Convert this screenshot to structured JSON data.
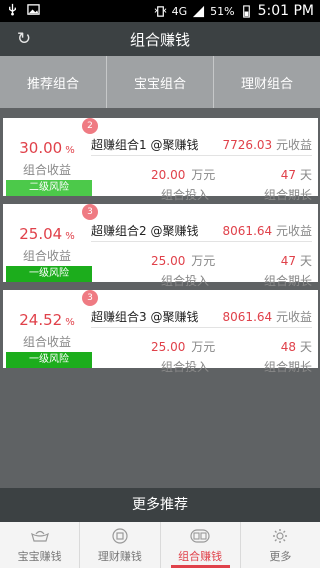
{
  "status_bar": {
    "network": "4G",
    "battery": "51%",
    "time": "5:01 PM"
  },
  "header": {
    "title": "组合赚钱",
    "refresh_icon": "refresh-icon"
  },
  "tabs": [
    {
      "label": "推荐组合"
    },
    {
      "label": "宝宝组合"
    },
    {
      "label": "理财组合"
    }
  ],
  "portfolios": [
    {
      "badge": "2",
      "rate": "30.00",
      "rate_unit": "%",
      "rate_label": "组合收益",
      "risk": "二级风险",
      "risk_color": "#4cc94a",
      "name": "超赚组合1 @聚赚钱",
      "income": "7726.03",
      "income_unit": "元收益",
      "amount": "20.00",
      "amount_unit": "万元",
      "amount_label": "组合投入",
      "duration": "47",
      "duration_unit": "天",
      "duration_label": "组合期长"
    },
    {
      "badge": "3",
      "rate": "25.04",
      "rate_unit": "%",
      "rate_label": "组合收益",
      "risk": "一级风险",
      "risk_color": "#1cad1c",
      "name": "超赚组合2 @聚赚钱",
      "income": "8061.64",
      "income_unit": "元收益",
      "amount": "25.00",
      "amount_unit": "万元",
      "amount_label": "组合投入",
      "duration": "47",
      "duration_unit": "天",
      "duration_label": "组合期长"
    },
    {
      "badge": "3",
      "rate": "24.52",
      "rate_unit": "%",
      "rate_label": "组合收益",
      "risk": "一级风险",
      "risk_color": "#1cad1c",
      "name": "超赚组合3 @聚赚钱",
      "income": "8061.64",
      "income_unit": "元收益",
      "amount": "25.00",
      "amount_unit": "万元",
      "amount_label": "组合投入",
      "duration": "48",
      "duration_unit": "天",
      "duration_label": "组合期长"
    }
  ],
  "more_button": "更多推荐",
  "bottom_nav": [
    {
      "label": "宝宝赚钱",
      "icon": "ingot-icon"
    },
    {
      "label": "理财赚钱",
      "icon": "coin-icon"
    },
    {
      "label": "组合赚钱",
      "icon": "coins-icon",
      "active": true
    },
    {
      "label": "更多",
      "icon": "gear-icon"
    }
  ],
  "colors": {
    "accent": "#e0414a",
    "header_bg": "#3c4143",
    "tab_bg": "#9fa2a4"
  }
}
